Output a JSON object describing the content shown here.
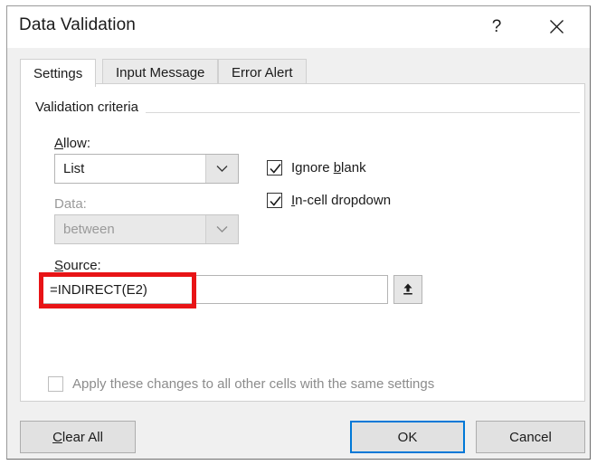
{
  "dialog": {
    "title": "Data Validation",
    "help_icon": "question-mark-icon",
    "close_icon": "close-icon"
  },
  "tabs": [
    {
      "label": "Settings",
      "active": true
    },
    {
      "label": "Input Message",
      "active": false
    },
    {
      "label": "Error Alert",
      "active": false
    }
  ],
  "settings": {
    "group_title": "Validation criteria",
    "allow": {
      "label_pre": "A",
      "label_accel": "l",
      "label_post": "low:",
      "label_full": "Allow:",
      "value": "List",
      "enabled": true,
      "chevron_icon": "chevron-down-icon"
    },
    "data": {
      "label_full": "Data:",
      "value": "between",
      "enabled": false,
      "chevron_icon": "chevron-down-icon"
    },
    "source": {
      "label_pre": "",
      "label_accel": "S",
      "label_post": "ource:",
      "label_full": "Source:",
      "value": "=INDIRECT(E2)",
      "placeholder": "",
      "range_picker_icon": "collapse-dialog-arrow-icon"
    },
    "checkboxes": [
      {
        "name": "ignore-blank",
        "pre": "Ignore ",
        "accel": "b",
        "post": "lank",
        "label_full": "Ignore blank",
        "checked": true,
        "enabled": true
      },
      {
        "name": "in-cell-dropdown",
        "pre": "",
        "accel": "I",
        "post": "n-cell dropdown",
        "label_full": "In-cell dropdown",
        "checked": true,
        "enabled": true
      }
    ],
    "apply_all": {
      "label_full": "Apply these changes to all other cells with the same settings",
      "checked": false,
      "enabled": false
    }
  },
  "footer": {
    "clear_all": {
      "pre": "",
      "accel": "C",
      "post": "lear All",
      "label_full": "Clear All"
    },
    "ok": {
      "label": "OK",
      "focused": true
    },
    "cancel": {
      "label": "Cancel",
      "focused": false
    }
  },
  "annotation": {
    "shape": "red-rectangle-highlight",
    "color": "#E81416",
    "targets": "source-input"
  },
  "colors": {
    "accent_focus": "#0078D7",
    "annotation_red": "#E81416",
    "dialog_bg": "#F0F0F0",
    "panel_bg": "#FFFFFF",
    "disabled_text": "#9A9A9A"
  }
}
